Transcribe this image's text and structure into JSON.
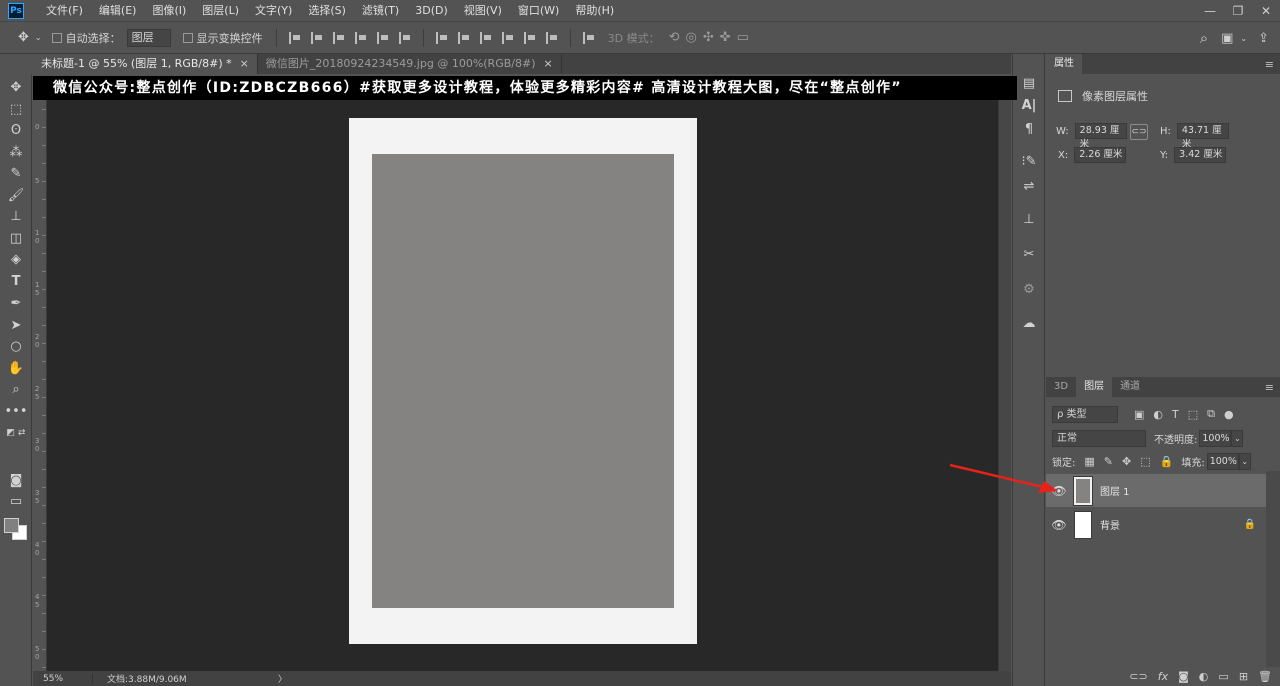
{
  "app": {
    "logo": "Ps"
  },
  "menu": [
    "文件(F)",
    "编辑(E)",
    "图像(I)",
    "图层(L)",
    "文字(Y)",
    "选择(S)",
    "滤镜(T)",
    "3D(D)",
    "视图(V)",
    "窗口(W)",
    "帮助(H)"
  ],
  "window_controls": {
    "minimize": "—",
    "maximize": "❐",
    "close": "✕"
  },
  "options": {
    "auto_select_label": "自动选择：",
    "auto_select_value": "图层",
    "show_transform_label": "显示变换控件",
    "mode_3d_label": "3D 模式："
  },
  "tabs": [
    {
      "label": "未标题-1 @ 55% (图层 1, RGB/8#) *",
      "close": "×",
      "active": true
    },
    {
      "label": "微信图片_20180924234549.jpg @ 100%(RGB/8#)",
      "close": "×",
      "active": false
    }
  ],
  "banner": "微信公众号:整点创作（ID:ZDBCZB666）#获取更多设计教程，体验更多精彩内容#  高清设计教程大图，尽在“整点创作”",
  "ruler_left_numbers": [
    "0",
    "5",
    "1 0",
    "1 5",
    "2 0",
    "2 5",
    "3 0",
    "3 5",
    "4 0",
    "4 5",
    "5 0"
  ],
  "status": {
    "zoom": "55%",
    "doc_size": "文档:3.88M/9.06M",
    "arrow": "〉"
  },
  "properties": {
    "tab": "属性",
    "title": "像素图层属性",
    "w_label": "W:",
    "w_value": "28.93 厘米",
    "h_label": "H:",
    "h_value": "43.71 厘米",
    "x_label": "X:",
    "x_value": "2.26 厘米",
    "y_label": "Y:",
    "y_value": "3.42 厘米"
  },
  "layers_panel": {
    "tabs": [
      "3D",
      "图层",
      "通道"
    ],
    "kind": "ρ 类型",
    "blend_mode": "正常",
    "opacity_label": "不透明度:",
    "opacity_value": "100%",
    "lock_label": "锁定:",
    "fill_label": "填充:",
    "fill_value": "100%",
    "layers": [
      {
        "name": "图层 1",
        "active": true
      },
      {
        "name": "背景",
        "active": false,
        "locked": true
      }
    ],
    "bottom_icons": [
      "link-icon",
      "fx-icon",
      "mask-icon",
      "adjustment-icon",
      "group-icon",
      "new-layer-icon",
      "trash-icon"
    ],
    "fx_label": "fx"
  },
  "colors": {
    "accent_annotation": "#e5231b",
    "foreground": "#808080",
    "background": "#ffffff",
    "layer_fill": "#848382"
  }
}
